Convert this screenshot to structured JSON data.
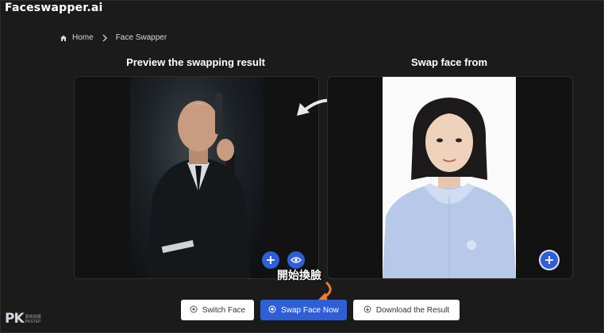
{
  "app": {
    "logo": "Faceswapper.ai"
  },
  "breadcrumb": {
    "home": "Home",
    "current": "Face Swapper"
  },
  "panels": {
    "left_title": "Preview the swapping result",
    "right_title": "Swap face from"
  },
  "annotation": {
    "text": "開始換臉"
  },
  "buttons": {
    "switch": "Switch Face",
    "swap": "Swap Face Now",
    "download": "Download the Result"
  },
  "watermark": {
    "brand": "PK",
    "sub1": "愛凱挑選",
    "sub2": "PKSTEP"
  },
  "colors": {
    "accent": "#2f5fd6",
    "annotation_arrow": "#f07c2a",
    "background": "#1b1b1b"
  }
}
